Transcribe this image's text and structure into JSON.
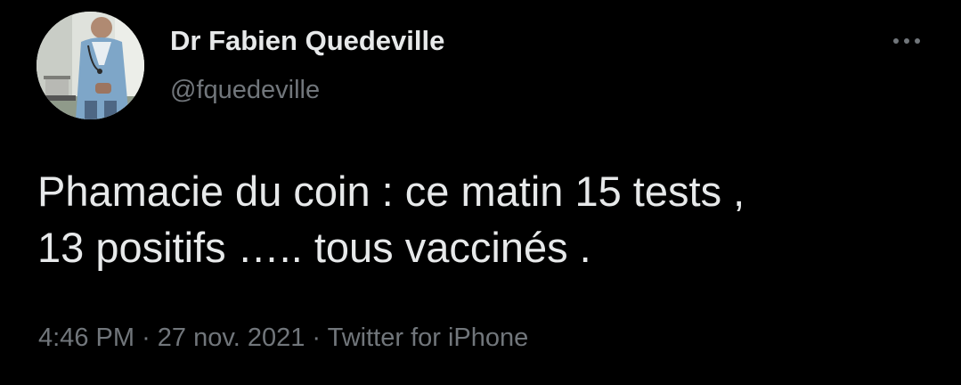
{
  "author": {
    "display_name": "Dr Fabien Quedeville",
    "handle": "@fquedeville",
    "avatar_icon": "profile-photo"
  },
  "menu_icon": "more-options-icon",
  "tweet": {
    "text_lines": [
      "Phamacie du coin : ce matin 15 tests ,",
      "13 positifs ….. tous vaccinés ."
    ]
  },
  "meta": {
    "time": "4:46 PM",
    "separator": "·",
    "date": "27 nov. 2021",
    "source": "Twitter for iPhone"
  },
  "colors": {
    "background": "#000000",
    "primary_text": "#e7e9ea",
    "secondary_text": "#71767b"
  }
}
